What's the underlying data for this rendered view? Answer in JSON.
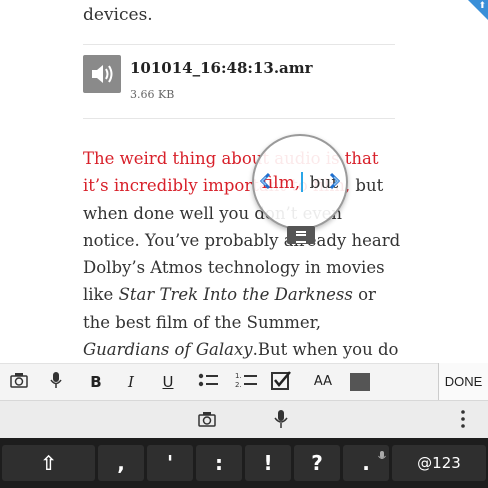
{
  "corner_badge": "⬆",
  "document": {
    "previous_line": "devices.",
    "attachment": {
      "icon": "speaker-icon",
      "name": "101014_16:48:13.amr",
      "size": "3.66 KB"
    },
    "paragraph": {
      "red_text": "The weird thing about audio is that it’s incredibly important to film,",
      "p1": " but when done well you don’t even notice. You’ve probably already heard Dolby’s Atmos technology in movies like ",
      "italic1": "Star Trek Into the Darkness",
      "p2": " or the best film of the Summer, ",
      "italic2": "Guardians of Galaxy",
      "p3": ".But when you do notice what’s going on with the"
    },
    "magnifier": {
      "text_red": "film,",
      "text_rest": " but"
    }
  },
  "format_toolbar": {
    "items": [
      "camera-icon",
      "microphone-icon",
      "bold",
      "italic",
      "underline",
      "bullet-list",
      "numbered-list",
      "checkbox",
      "font-size",
      "text-color"
    ],
    "bold_label": "B",
    "italic_label": "I",
    "underline_label": "U",
    "font_size_label": "AA",
    "done_label": "DONE",
    "text_color": "#555555"
  },
  "insert_bar": {
    "items": [
      "camera-icon",
      "microphone-icon",
      "more-icon"
    ]
  },
  "keyboard": {
    "keys": [
      "⇧",
      ",",
      "'",
      ":",
      "!",
      "?",
      "."
    ],
    "symbol_key": "@123"
  },
  "colors": {
    "accent_red": "#d8202a",
    "selection_caret": "#2aa6e8",
    "handle_arrows": "#1e6fcf"
  }
}
